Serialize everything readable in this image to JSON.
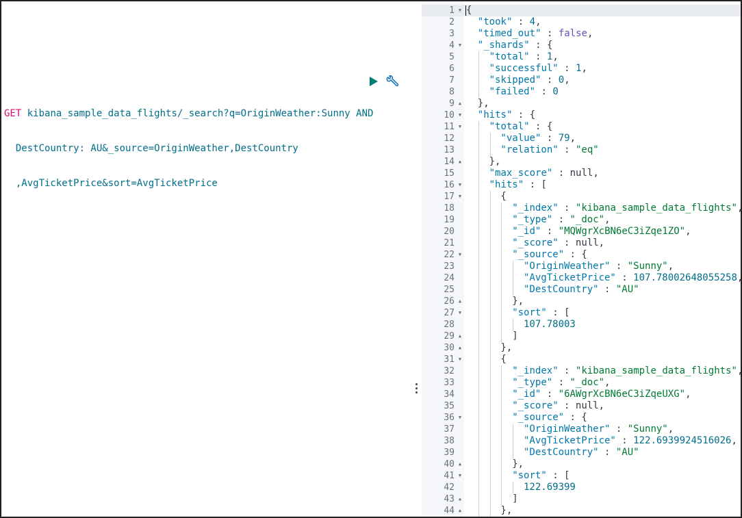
{
  "request": {
    "method": "GET",
    "lines": [
      " kibana_sample_data_flights/_search?q=OriginWeather:Sunny AND",
      "  DestCountry: AU&_source=OriginWeather,DestCountry",
      "  ,AvgTicketPrice&sort=AvgTicketPrice"
    ],
    "run_icon": "play-icon",
    "tools_icon": "wrench-icon"
  },
  "response": {
    "lines": [
      {
        "n": "1",
        "fold": "open",
        "indent": 0,
        "tokens": [
          [
            "p",
            "{"
          ]
        ]
      },
      {
        "n": "2",
        "fold": "",
        "indent": 1,
        "tokens": [
          [
            "k",
            "\"took\""
          ],
          [
            "p",
            " : "
          ],
          [
            "n",
            "4"
          ],
          [
            "p",
            ","
          ]
        ]
      },
      {
        "n": "3",
        "fold": "",
        "indent": 1,
        "tokens": [
          [
            "k",
            "\"timed_out\""
          ],
          [
            "p",
            " : "
          ],
          [
            "b",
            "false"
          ],
          [
            "p",
            ","
          ]
        ]
      },
      {
        "n": "4",
        "fold": "open",
        "indent": 1,
        "tokens": [
          [
            "k",
            "\"_shards\""
          ],
          [
            "p",
            " : {"
          ]
        ]
      },
      {
        "n": "5",
        "fold": "",
        "indent": 2,
        "tokens": [
          [
            "k",
            "\"total\""
          ],
          [
            "p",
            " : "
          ],
          [
            "n",
            "1"
          ],
          [
            "p",
            ","
          ]
        ]
      },
      {
        "n": "6",
        "fold": "",
        "indent": 2,
        "tokens": [
          [
            "k",
            "\"successful\""
          ],
          [
            "p",
            " : "
          ],
          [
            "n",
            "1"
          ],
          [
            "p",
            ","
          ]
        ]
      },
      {
        "n": "7",
        "fold": "",
        "indent": 2,
        "tokens": [
          [
            "k",
            "\"skipped\""
          ],
          [
            "p",
            " : "
          ],
          [
            "n",
            "0"
          ],
          [
            "p",
            ","
          ]
        ]
      },
      {
        "n": "8",
        "fold": "",
        "indent": 2,
        "tokens": [
          [
            "k",
            "\"failed\""
          ],
          [
            "p",
            " : "
          ],
          [
            "n",
            "0"
          ]
        ]
      },
      {
        "n": "9",
        "fold": "close",
        "indent": 1,
        "tokens": [
          [
            "p",
            "},"
          ]
        ]
      },
      {
        "n": "10",
        "fold": "open",
        "indent": 1,
        "tokens": [
          [
            "k",
            "\"hits\""
          ],
          [
            "p",
            " : {"
          ]
        ]
      },
      {
        "n": "11",
        "fold": "open",
        "indent": 2,
        "tokens": [
          [
            "k",
            "\"total\""
          ],
          [
            "p",
            " : {"
          ]
        ]
      },
      {
        "n": "12",
        "fold": "",
        "indent": 3,
        "tokens": [
          [
            "k",
            "\"value\""
          ],
          [
            "p",
            " : "
          ],
          [
            "n",
            "79"
          ],
          [
            "p",
            ","
          ]
        ]
      },
      {
        "n": "13",
        "fold": "",
        "indent": 3,
        "tokens": [
          [
            "k",
            "\"relation\""
          ],
          [
            "p",
            " : "
          ],
          [
            "s",
            "\"eq\""
          ]
        ]
      },
      {
        "n": "14",
        "fold": "close",
        "indent": 2,
        "tokens": [
          [
            "p",
            "},"
          ]
        ]
      },
      {
        "n": "15",
        "fold": "",
        "indent": 2,
        "tokens": [
          [
            "k",
            "\"max_score\""
          ],
          [
            "p",
            " : null,"
          ]
        ]
      },
      {
        "n": "16",
        "fold": "open",
        "indent": 2,
        "tokens": [
          [
            "k",
            "\"hits\""
          ],
          [
            "p",
            " : ["
          ]
        ]
      },
      {
        "n": "17",
        "fold": "open",
        "indent": 3,
        "tokens": [
          [
            "p",
            "{"
          ]
        ]
      },
      {
        "n": "18",
        "fold": "",
        "indent": 4,
        "tokens": [
          [
            "k",
            "\"_index\""
          ],
          [
            "p",
            " : "
          ],
          [
            "s",
            "\"kibana_sample_data_flights\""
          ],
          [
            "p",
            ","
          ]
        ]
      },
      {
        "n": "19",
        "fold": "",
        "indent": 4,
        "tokens": [
          [
            "k",
            "\"_type\""
          ],
          [
            "p",
            " : "
          ],
          [
            "s",
            "\"_doc\""
          ],
          [
            "p",
            ","
          ]
        ]
      },
      {
        "n": "20",
        "fold": "",
        "indent": 4,
        "tokens": [
          [
            "k",
            "\"_id\""
          ],
          [
            "p",
            " : "
          ],
          [
            "s",
            "\"MQWgrXcBN6eC3iZqe1ZO\""
          ],
          [
            "p",
            ","
          ]
        ]
      },
      {
        "n": "21",
        "fold": "",
        "indent": 4,
        "tokens": [
          [
            "k",
            "\"_score\""
          ],
          [
            "p",
            " : null,"
          ]
        ]
      },
      {
        "n": "22",
        "fold": "open",
        "indent": 4,
        "tokens": [
          [
            "k",
            "\"_source\""
          ],
          [
            "p",
            " : {"
          ]
        ]
      },
      {
        "n": "23",
        "fold": "",
        "indent": 5,
        "tokens": [
          [
            "k",
            "\"OriginWeather\""
          ],
          [
            "p",
            " : "
          ],
          [
            "s",
            "\"Sunny\""
          ],
          [
            "p",
            ","
          ]
        ]
      },
      {
        "n": "24",
        "fold": "",
        "indent": 5,
        "tokens": [
          [
            "k",
            "\"AvgTicketPrice\""
          ],
          [
            "p",
            " : "
          ],
          [
            "n",
            "107.78002648055258"
          ],
          [
            "p",
            ","
          ]
        ]
      },
      {
        "n": "25",
        "fold": "",
        "indent": 5,
        "tokens": [
          [
            "k",
            "\"DestCountry\""
          ],
          [
            "p",
            " : "
          ],
          [
            "s",
            "\"AU\""
          ]
        ]
      },
      {
        "n": "26",
        "fold": "close",
        "indent": 4,
        "tokens": [
          [
            "p",
            "},"
          ]
        ]
      },
      {
        "n": "27",
        "fold": "open",
        "indent": 4,
        "tokens": [
          [
            "k",
            "\"sort\""
          ],
          [
            "p",
            " : ["
          ]
        ]
      },
      {
        "n": "28",
        "fold": "",
        "indent": 5,
        "tokens": [
          [
            "n",
            "107.78003"
          ]
        ]
      },
      {
        "n": "29",
        "fold": "close",
        "indent": 4,
        "tokens": [
          [
            "p",
            "]"
          ]
        ]
      },
      {
        "n": "30",
        "fold": "close",
        "indent": 3,
        "tokens": [
          [
            "p",
            "},"
          ]
        ]
      },
      {
        "n": "31",
        "fold": "open",
        "indent": 3,
        "tokens": [
          [
            "p",
            "{"
          ]
        ]
      },
      {
        "n": "32",
        "fold": "",
        "indent": 4,
        "tokens": [
          [
            "k",
            "\"_index\""
          ],
          [
            "p",
            " : "
          ],
          [
            "s",
            "\"kibana_sample_data_flights\""
          ],
          [
            "p",
            ","
          ]
        ]
      },
      {
        "n": "33",
        "fold": "",
        "indent": 4,
        "tokens": [
          [
            "k",
            "\"_type\""
          ],
          [
            "p",
            " : "
          ],
          [
            "s",
            "\"_doc\""
          ],
          [
            "p",
            ","
          ]
        ]
      },
      {
        "n": "34",
        "fold": "",
        "indent": 4,
        "tokens": [
          [
            "k",
            "\"_id\""
          ],
          [
            "p",
            " : "
          ],
          [
            "s",
            "\"6AWgrXcBN6eC3iZqeUXG\""
          ],
          [
            "p",
            ","
          ]
        ]
      },
      {
        "n": "35",
        "fold": "",
        "indent": 4,
        "tokens": [
          [
            "k",
            "\"_score\""
          ],
          [
            "p",
            " : null,"
          ]
        ]
      },
      {
        "n": "36",
        "fold": "open",
        "indent": 4,
        "tokens": [
          [
            "k",
            "\"_source\""
          ],
          [
            "p",
            " : {"
          ]
        ]
      },
      {
        "n": "37",
        "fold": "",
        "indent": 5,
        "tokens": [
          [
            "k",
            "\"OriginWeather\""
          ],
          [
            "p",
            " : "
          ],
          [
            "s",
            "\"Sunny\""
          ],
          [
            "p",
            ","
          ]
        ]
      },
      {
        "n": "38",
        "fold": "",
        "indent": 5,
        "tokens": [
          [
            "k",
            "\"AvgTicketPrice\""
          ],
          [
            "p",
            " : "
          ],
          [
            "n",
            "122.6939924516026"
          ],
          [
            "p",
            ","
          ]
        ]
      },
      {
        "n": "39",
        "fold": "",
        "indent": 5,
        "tokens": [
          [
            "k",
            "\"DestCountry\""
          ],
          [
            "p",
            " : "
          ],
          [
            "s",
            "\"AU\""
          ]
        ]
      },
      {
        "n": "40",
        "fold": "close",
        "indent": 4,
        "tokens": [
          [
            "p",
            "},"
          ]
        ]
      },
      {
        "n": "41",
        "fold": "open",
        "indent": 4,
        "tokens": [
          [
            "k",
            "\"sort\""
          ],
          [
            "p",
            " : ["
          ]
        ]
      },
      {
        "n": "42",
        "fold": "",
        "indent": 5,
        "tokens": [
          [
            "n",
            "122.69399"
          ]
        ]
      },
      {
        "n": "43",
        "fold": "close",
        "indent": 4,
        "tokens": [
          [
            "p",
            "]"
          ]
        ]
      },
      {
        "n": "44",
        "fold": "close",
        "indent": 3,
        "tokens": [
          [
            "p",
            "},"
          ]
        ]
      }
    ]
  },
  "colors": {
    "method": "#dd0a73",
    "key": "#0077aa",
    "string": "#007a33",
    "number": "#006e8a",
    "boolean": "#6b4fbb",
    "gutter": "#f5f7fa"
  }
}
